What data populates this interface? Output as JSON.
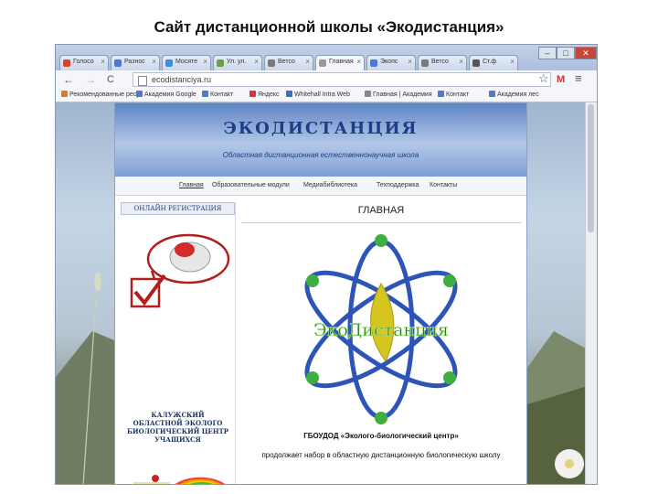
{
  "slide": {
    "title": "Сайт дистанционной школы «Экодистанция»"
  },
  "browser": {
    "tabs": [
      {
        "label": "Голосо",
        "color": "#d9442f"
      },
      {
        "label": "Разнос",
        "color": "#4a7ad6"
      },
      {
        "label": "Мосяте",
        "color": "#3e8fd8"
      },
      {
        "label": "Ул. ул.",
        "color": "#6aa04a"
      },
      {
        "label": "Ветсо",
        "color": "#7a7a7a"
      },
      {
        "label": "Главная",
        "color": "#9a9a9a",
        "active": true
      },
      {
        "label": "Экопс",
        "color": "#4a7ad6"
      },
      {
        "label": "Ветсо",
        "color": "#7a7a7a"
      },
      {
        "label": "Ст.ф",
        "color": "#555555"
      }
    ],
    "window_controls": {
      "minimize": "–",
      "maximize": "□",
      "close": "✕"
    },
    "nav": {
      "back": "←",
      "forward": "→",
      "reload": "C",
      "star": "☆",
      "menu": "≡"
    },
    "address": "ecodistanciya.ru",
    "bookmarks": [
      {
        "label": "Рекомендованные ресу",
        "color": "#e07b22"
      },
      {
        "label": "Академия Google",
        "color": "#4a7ad6"
      },
      {
        "label": "Контакт",
        "color": "#4a7ad6"
      },
      {
        "label": "Яндекс",
        "color": "#d33"
      },
      {
        "label": "Whitehall Intra Web",
        "color": "#3a6fc4"
      },
      {
        "label": "Главная | Академия",
        "color": "#888"
      },
      {
        "label": "Контакт",
        "color": "#4a7ad6"
      },
      {
        "label": "Академия лес",
        "color": "#4a7ad6"
      }
    ]
  },
  "site": {
    "title": "ЭКОДИСТАНЦИЯ",
    "subtitle": "Областная дистанционная естественнонаучная школа",
    "menu": [
      "Главная",
      "Образовательные модули",
      "Медиабиблиотека",
      "Техподдержка",
      "Контакты"
    ],
    "sidebar": {
      "registration": "ОНЛАЙН РЕГИСТРАЦИЯ",
      "org_name": [
        "КАЛУЖСКИЙ",
        "ОБЛАСТНОЙ ЭКОЛОГО",
        "БИОЛОГИЧЕСКИЙ ЦЕНТР",
        "УЧАЩИХСЯ"
      ]
    },
    "main": {
      "heading": "ГЛАВНАЯ",
      "logo_text": "ЭкоДистанция",
      "org_line": "ГБОУДОД «Эколого-биологический центр»",
      "description": "продолжает набор в областную дистанционную биологическую школу"
    }
  }
}
